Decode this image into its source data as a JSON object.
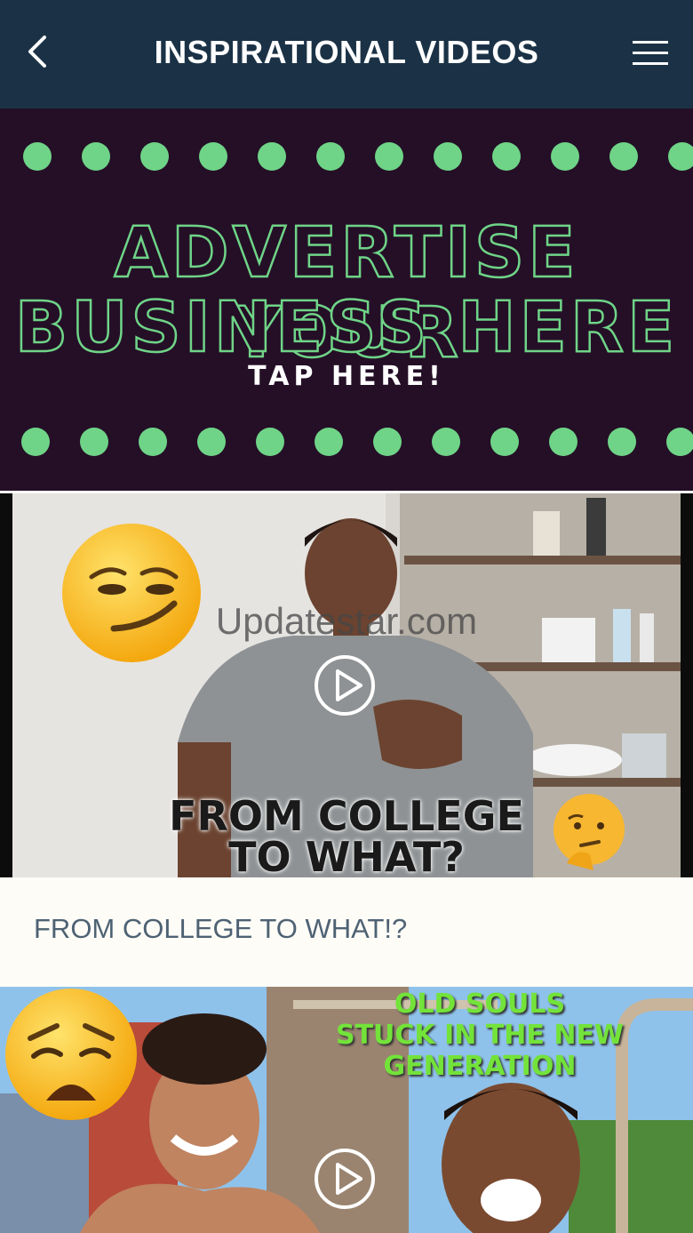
{
  "header": {
    "title": "INSPIRATIONAL VIDEOS",
    "back_icon": "chevron-left-icon",
    "menu_icon": "hamburger-menu-icon",
    "background_color": "#1b3246"
  },
  "ad_banner": {
    "line1": "ADVERTISE YOUR",
    "line2": "BUSINESS HERE",
    "tap_text": "TAP HERE!",
    "background_color": "#240f27",
    "accent_color": "#6fd487"
  },
  "videos": [
    {
      "overlay_title_line1": "FROM COLLEGE",
      "overlay_title_line2": "TO WHAT?",
      "watermark": "Updatestar.com",
      "caption": "FROM COLLEGE TO WHAT!?",
      "emojis": [
        "smirking-face-icon",
        "thinking-face-icon"
      ],
      "play_icon": "play-icon"
    },
    {
      "overlay_title_line1": "OLD SOULS",
      "overlay_title_line2": "STUCK IN THE NEW",
      "overlay_title_line3": "GENERATION",
      "overlay_color": "#73e33a",
      "emojis": [
        "weary-face-icon"
      ],
      "play_icon": "play-icon"
    }
  ]
}
